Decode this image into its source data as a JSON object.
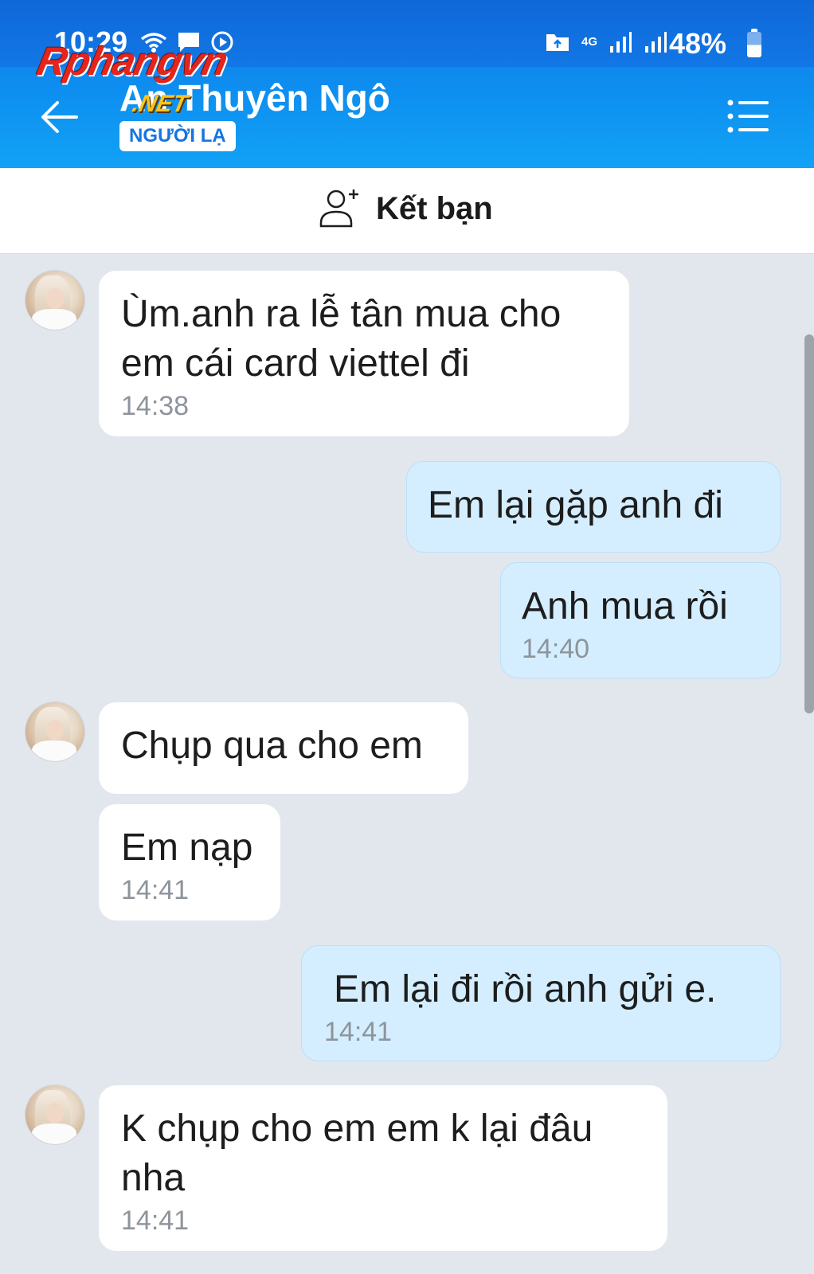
{
  "status_bar": {
    "time": "10:29",
    "network": "4G",
    "battery": "48%",
    "battery_level": 0.48,
    "icons_left": [
      "wifi-icon",
      "message-icon",
      "media-icon"
    ],
    "icons_right": [
      "folder-icon",
      "signal-icon",
      "signal-icon"
    ]
  },
  "header": {
    "contact_name": "An Thuyên Ngô",
    "badge": "NGƯỜI LẠ",
    "back_icon": "back-arrow-icon",
    "menu_icon": "list-menu-icon",
    "background": "#0d8ff0"
  },
  "watermark": {
    "main": "Rphangvn",
    "suffix": ".NET"
  },
  "friend_bar": {
    "label": "Kết bạn",
    "icon": "add-person-icon"
  },
  "messages": [
    {
      "from": "contact",
      "lines": [
        "Ùm.anh ra lễ tân mua cho",
        "em cái card viettel đi"
      ],
      "time": "14:38"
    },
    {
      "from": "me",
      "lines": [
        "Em lại gặp anh đi"
      ],
      "time": ""
    },
    {
      "from": "me",
      "lines": [
        "Anh mua rồi"
      ],
      "time": "14:40"
    },
    {
      "from": "contact",
      "lines": [
        "Chụp qua cho em"
      ],
      "time": ""
    },
    {
      "from": "contact",
      "lines": [
        "Em nạp"
      ],
      "time": "14:41"
    },
    {
      "from": "me",
      "lines": [
        "Em lại đi rồi anh gửi e."
      ],
      "time": "14:41"
    },
    {
      "from": "contact",
      "lines": [
        "K chụp cho em em k lại đâu",
        "nha"
      ],
      "time": "14:41"
    }
  ],
  "colors": {
    "incoming_bubble": "#ffffff",
    "outgoing_bubble": "#d4eeff",
    "chat_background": "#e2e7ee",
    "badge_text": "#1675e0"
  }
}
